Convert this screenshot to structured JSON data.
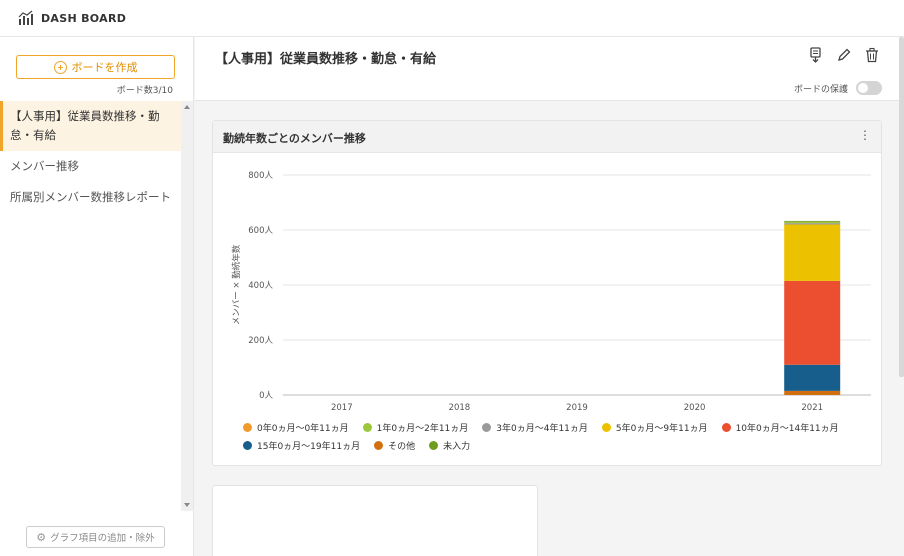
{
  "app": {
    "title": "DASH BOARD"
  },
  "sidebar": {
    "create_button": "ボードを作成",
    "board_count": "ボード数3/10",
    "items": [
      {
        "label": "【人事用】従業員数推移・勤怠・有給",
        "active": true
      },
      {
        "label": "メンバー推移",
        "active": false
      },
      {
        "label": "所属別メンバー数推移レポート",
        "active": false
      }
    ],
    "graph_button": "グラフ項目の追加・除外"
  },
  "header": {
    "board_title": "【人事用】従業員数推移・勤怠・有給",
    "protect_label": "ボードの保護",
    "protect_on": false
  },
  "card": {
    "title": "勤続年数ごとのメンバー推移"
  },
  "chart_data": {
    "type": "bar",
    "stacked": true,
    "categories": [
      "2017",
      "2018",
      "2019",
      "2020",
      "2021"
    ],
    "ylabel": "メンバー × 勤続年数",
    "ylim": [
      0,
      800
    ],
    "yticks": [
      "0人",
      "200人",
      "400人",
      "600人",
      "800人"
    ],
    "ytick_values": [
      0,
      200,
      400,
      600,
      800
    ],
    "grid": true,
    "legend_position": "bottom",
    "series": [
      {
        "name": "0年0ヵ月～0年11ヵ月",
        "color": "#f39a2d",
        "values": [
          0,
          0,
          0,
          0,
          0
        ]
      },
      {
        "name": "1年0ヵ月～2年11ヵ月",
        "color": "#9cc73a",
        "values": [
          0,
          0,
          0,
          0,
          5
        ]
      },
      {
        "name": "3年0ヵ月～4年11ヵ月",
        "color": "#9a9a9a",
        "values": [
          0,
          0,
          0,
          0,
          5
        ]
      },
      {
        "name": "5年0ヵ月～9年11ヵ月",
        "color": "#ecc100",
        "values": [
          0,
          0,
          0,
          0,
          205
        ]
      },
      {
        "name": "10年0ヵ月～14年11ヵ月",
        "color": "#ec4f2f",
        "values": [
          0,
          0,
          0,
          0,
          305
        ]
      },
      {
        "name": "15年0ヵ月～19年11ヵ月",
        "color": "#175e8c",
        "values": [
          0,
          0,
          0,
          0,
          95
        ]
      },
      {
        "name": "その他",
        "color": "#d2700f",
        "values": [
          0,
          0,
          0,
          0,
          15
        ]
      },
      {
        "name": "未入力",
        "color": "#6f9e1e",
        "values": [
          0,
          0,
          0,
          0,
          3
        ]
      }
    ],
    "stack_order_bottom_to_top": [
      "その他",
      "15年0ヵ月～19年11ヵ月",
      "10年0ヵ月～14年11ヵ月",
      "5年0ヵ月～9年11ヵ月",
      "3年0ヵ月～4年11ヵ月",
      "1年0ヵ月～2年11ヵ月",
      "未入力",
      "0年0ヵ月～0年11ヵ月"
    ]
  },
  "legend_rows": [
    [
      "0年0ヵ月～0年11ヵ月",
      "1年0ヵ月～2年11ヵ月",
      "3年0ヵ月～4年11ヵ月",
      "5年0ヵ月～9年11ヵ月",
      "10年0ヵ月～14年11ヵ月"
    ],
    [
      "15年0ヵ月～19年11ヵ月",
      "その他",
      "未入力"
    ]
  ],
  "icons": {
    "logo": "bar-chart-icon",
    "export": "export-icon",
    "edit": "pencil-icon",
    "delete": "trash-icon",
    "more": "more-vertical-icon",
    "gear": "gear-icon"
  }
}
